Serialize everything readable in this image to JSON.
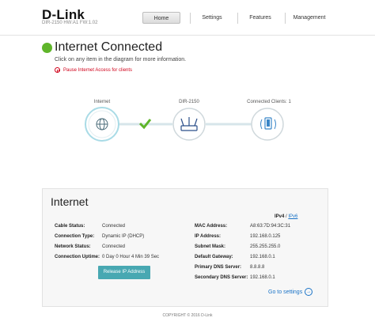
{
  "brand": {
    "logo": "D-Link",
    "model": "DIR-2150 HW:A1 FW:1.02"
  },
  "nav": {
    "home": "Home",
    "settings": "Settings",
    "features": "Features",
    "management": "Management"
  },
  "status": {
    "title": "Internet Connected",
    "subtitle": "Click on any item in the diagram for more information.",
    "pause": "Pause Internet Access for clients"
  },
  "diagram": {
    "internet_label": "Internet",
    "router_label": "DIR-2150",
    "clients_label": "Connected Clients: 1"
  },
  "internet": {
    "title": "Internet",
    "ipv4": "IPv4",
    "ipv_sep": "/",
    "ipv6": "IPv6",
    "left": [
      {
        "label": "Cable Status:",
        "value": "Connected"
      },
      {
        "label": "Connection Type:",
        "value": "Dynamic IP (DHCP)"
      },
      {
        "label": "Network Status:",
        "value": "Connected"
      },
      {
        "label": "Connection Uptime:",
        "value": "0 Day 0 Hour 4 Min 39 Sec"
      }
    ],
    "right": [
      {
        "label": "MAC Address:",
        "value": "A8:63:7D:94:3C:31"
      },
      {
        "label": "IP Address:",
        "value": "192.168.0.125"
      },
      {
        "label": "Subnet Mask:",
        "value": "255.255.255.0"
      },
      {
        "label": "Default Gateway:",
        "value": "192.168.0.1"
      },
      {
        "label": "Primary DNS Server:",
        "value": "8.8.8.8"
      },
      {
        "label": "Secondary DNS Server:",
        "value": "192.168.0.1"
      }
    ],
    "release_button": "Release IP Address",
    "goto_settings": "Go to settings"
  },
  "footer": {
    "copyright": "COPYRIGHT © 2016 D-Link"
  },
  "colors": {
    "connected": "#5fb52a",
    "accent": "#48a8b2",
    "link": "#1a73c7",
    "alert": "#d0021b"
  }
}
